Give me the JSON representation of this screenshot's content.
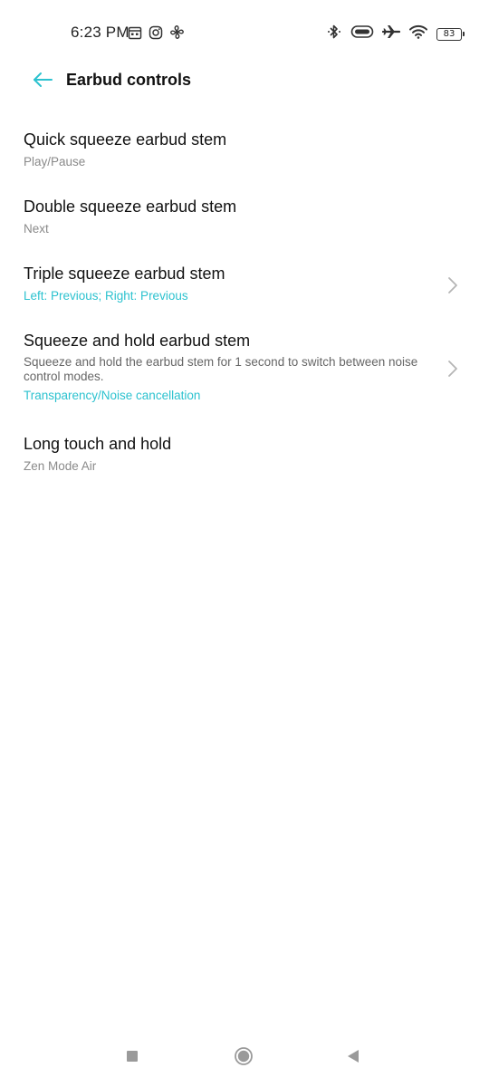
{
  "status_bar": {
    "time": "6:23 PM",
    "battery_level": "83",
    "left_icons": [
      "calendar-icon",
      "instagram-icon",
      "fan-icon"
    ],
    "right_icons": [
      "bluetooth-icon",
      "earbuds-battery-icon",
      "airplane-icon",
      "wifi-icon",
      "battery-icon"
    ]
  },
  "header": {
    "title": "Earbud controls",
    "back_icon": "arrow-left-icon",
    "accent_color": "#2cc2cf"
  },
  "settings": {
    "items": [
      {
        "title": "Quick squeeze earbud stem",
        "value": "Play/Pause",
        "has_chevron": false
      },
      {
        "title": "Double squeeze earbud stem",
        "value": "Next",
        "has_chevron": false
      },
      {
        "title": "Triple squeeze earbud stem",
        "value": "Left: Previous; Right: Previous",
        "value_accent": true,
        "has_chevron": true
      },
      {
        "title": "Squeeze and hold earbud stem",
        "description": "Squeeze and hold the earbud stem for 1 second to switch between noise control modes.",
        "value": "Transparency/Noise cancellation",
        "value_accent": true,
        "has_chevron": true
      },
      {
        "title": "Long touch and hold",
        "value": "Zen Mode Air",
        "has_chevron": false
      }
    ]
  },
  "nav_bar": {
    "buttons": [
      "square-icon",
      "circle-icon",
      "triangle-back-icon"
    ]
  }
}
